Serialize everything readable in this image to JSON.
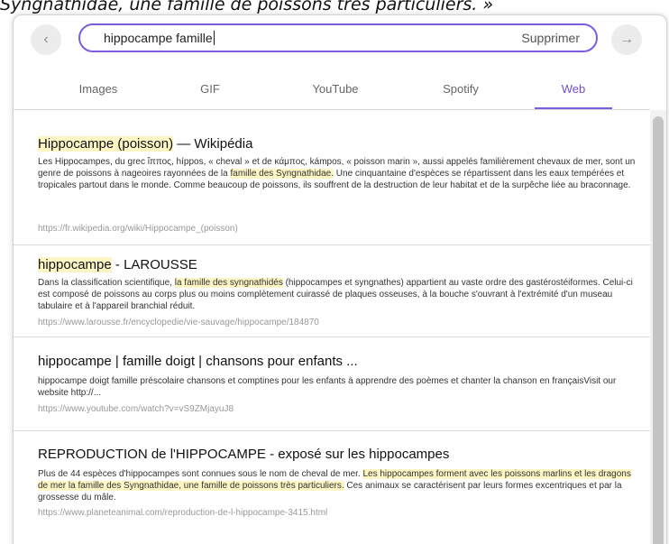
{
  "background": {
    "caption": "Syngnathidae, une famille de poissons très particuliers. »"
  },
  "search": {
    "query": "hippocampe famille",
    "clear_label": "Supprimer"
  },
  "tabs": [
    {
      "label": "Images"
    },
    {
      "label": "GIF"
    },
    {
      "label": "YouTube"
    },
    {
      "label": "Spotify"
    },
    {
      "label": "Web",
      "active": true
    }
  ],
  "colors": {
    "accent": "#7c5ce0",
    "highlight": "#fdf5c4"
  },
  "results": [
    {
      "title_hl": "Hippocampe (poisson)",
      "title_rest": " — Wikipédia",
      "desc_a": "Les Hippocampes, du grec ἵππος, híppos, « cheval » et de κάμπος, kámpos, « poisson marin », aussi appelés familièrement chevaux de mer, sont un genre de poissons à nageoires rayonnées de la ",
      "desc_hl": "famille des Syngnathidae.",
      "desc_b": " Une cinquantaine d'espèces se répartissent dans les eaux tempérées et tropicales partout dans le monde. Comme beaucoup de poissons, ils souffrent de la destruction de leur habitat et de la surpêche liée au braconnage.",
      "url": "https://fr.wikipedia.org/wiki/Hippocampe_(poisson)"
    },
    {
      "title_hl": "hippocampe",
      "title_rest": " - LAROUSSE",
      "desc_a": "Dans la classification scientifique, ",
      "desc_hl": "la famille des syngnathidés",
      "desc_b": " (hippocampes et syngnathes) appartient au vaste ordre des gastérostéiformes. Celui-ci est composé de poissons au corps plus ou moins complètement cuirassé de plaques osseuses, à la bouche s'ouvrant à l'extrémité d'un museau tabulaire et à l'appareil branchial réduit.",
      "url": "https://www.larousse.fr/encyclopedie/vie-sauvage/hippocampe/184870"
    },
    {
      "title": "hippocampe | famille doigt | chansons pour enfants ...",
      "desc": "hippocampe doigt famille préscolaire chansons et comptines pour les enfants à apprendre des poèmes et chanter la chanson en françaisVisit our website http://...",
      "url": "https://www.youtube.com/watch?v=vS9ZMjayuJ8"
    },
    {
      "title": "REPRODUCTION de l'HIPPOCAMPE - exposé sur les hippocampes",
      "desc_a": "Plus de 44 espèces d'hippocampes sont connues sous le nom de cheval de mer. ",
      "desc_hl": "Les hippocampes forment avec les poissons marlins et les dragons de mer la famille des Syngnathidae, une famille de poissons très particuliers.",
      "desc_b": " Ces animaux se caractérisent par leurs formes excentriques et par la grossesse du mâle.",
      "url": "https://www.planeteanimal.com/reproduction-de-l-hippocampe-3415.html"
    }
  ]
}
